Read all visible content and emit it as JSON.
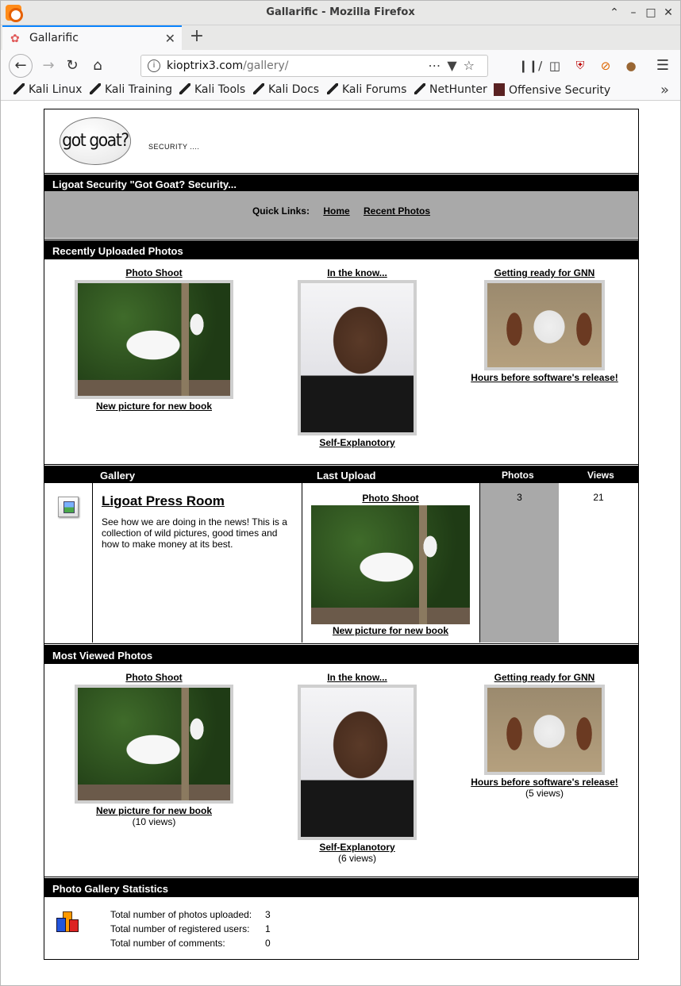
{
  "browser": {
    "window_title": "Gallarific - Mozilla Firefox",
    "tab_title": "Gallarific",
    "url_host": "kioptrix3.com",
    "url_path": "/gallery/",
    "bookmarks": [
      "Kali Linux",
      "Kali Training",
      "Kali Tools",
      "Kali Docs",
      "Kali Forums",
      "NetHunter",
      "Offensive Security"
    ]
  },
  "header": {
    "logo_text": "got goat?",
    "tagline": "SECURITY ...."
  },
  "site_bar": "Ligoat Security \"Got Goat? Security...",
  "quicklinks": {
    "label": "Quick Links:",
    "home": "Home",
    "recent": "Recent Photos"
  },
  "recent": {
    "heading": "Recently Uploaded Photos",
    "items": [
      {
        "title": "Photo Shoot",
        "caption": "New picture for new book"
      },
      {
        "title": "In the know...",
        "caption": "Self-Explanotory"
      },
      {
        "title": "Getting ready for GNN",
        "caption": "Hours before software's release!"
      }
    ]
  },
  "gallery": {
    "col_gallery": "Gallery",
    "col_last_upload": "Last Upload",
    "col_photos": "Photos",
    "col_views": "Views",
    "album_title": "Ligoat Press Room",
    "album_desc": "See how we are doing in the news! This is a collection of wild pictures, good times and how to make money at its best.",
    "last_title": "Photo Shoot",
    "last_caption": "New picture for new book",
    "photos": "3",
    "views": "21"
  },
  "most_viewed": {
    "heading": "Most Viewed Photos",
    "items": [
      {
        "title": "Photo Shoot",
        "caption": "New picture for new book",
        "views": "(10 views)"
      },
      {
        "title": "In the know...",
        "caption": "Self-Explanotory",
        "views": "(6 views)"
      },
      {
        "title": "Getting ready for GNN",
        "caption": "Hours before software's release!",
        "views": "(5 views)"
      }
    ]
  },
  "stats": {
    "heading": "Photo Gallery Statistics",
    "rows": [
      {
        "label": "Total number of photos uploaded:",
        "value": "3"
      },
      {
        "label": "Total number of registered users:",
        "value": "1"
      },
      {
        "label": "Total number of comments:",
        "value": "0"
      }
    ]
  }
}
